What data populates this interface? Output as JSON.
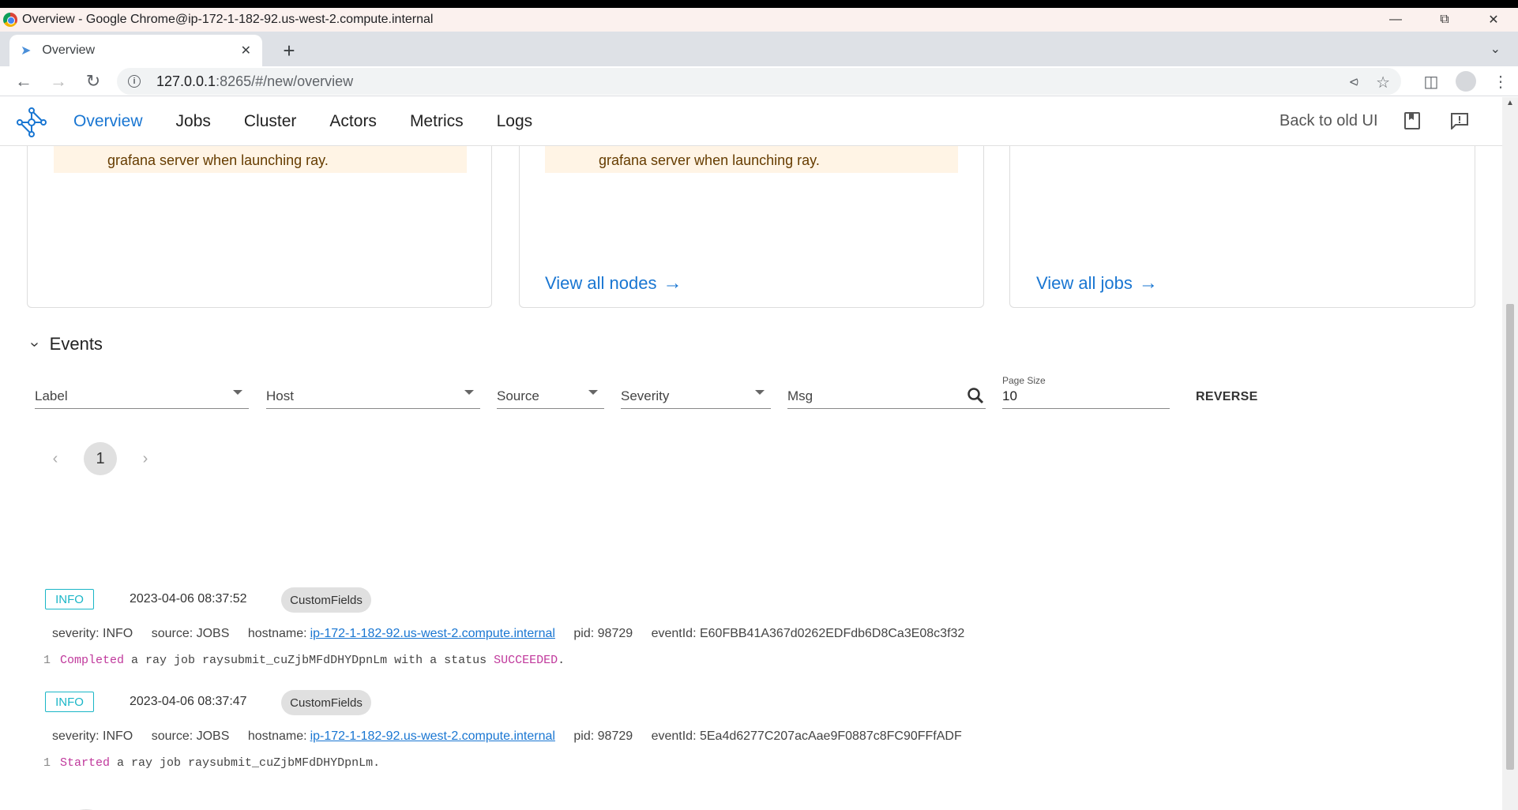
{
  "browser": {
    "window_title": "Overview - Google Chrome@ip-172-1-182-92.us-west-2.compute.internal",
    "tab_title": "Overview",
    "url_host": "127.0.0.1",
    "url_rest": ":8265/#/new/overview"
  },
  "appbar": {
    "nav": [
      "Overview",
      "Jobs",
      "Cluster",
      "Actors",
      "Metrics",
      "Logs"
    ],
    "active": "Overview",
    "back_label": "Back to old UI"
  },
  "cards": {
    "warning_text": "grafana server when launching ray.",
    "view_nodes": "View all nodes",
    "view_jobs": "View all jobs"
  },
  "events": {
    "title": "Events",
    "filters": {
      "label": "Label",
      "host": "Host",
      "source": "Source",
      "severity": "Severity",
      "msg": "Msg",
      "page_size_label": "Page Size",
      "page_size": "10",
      "reverse": "REVERSE"
    },
    "page": "1",
    "items": [
      {
        "level": "INFO",
        "time": "2023-04-06 08:37:52",
        "chip": "CustomFields",
        "severity": "severity: INFO",
        "source": "source: JOBS",
        "hostname_label": "hostname:",
        "hostname": "ip-172-1-182-92.us-west-2.compute.internal",
        "pid": "pid: 98729",
        "event_id": "eventId: E60FBB41A367d0262EDFdb6D8Ca3E08c3f32",
        "line_no": "1",
        "msg_kw1": "Completed",
        "msg_mid": " a ray job raysubmit_cuZjbMFdDHYDpnLm with a status ",
        "msg_kw2": "SUCCEEDED",
        "msg_end": "."
      },
      {
        "level": "INFO",
        "time": "2023-04-06 08:37:47",
        "chip": "CustomFields",
        "severity": "severity: INFO",
        "source": "source: JOBS",
        "hostname_label": "hostname:",
        "hostname": "ip-172-1-182-92.us-west-2.compute.internal",
        "pid": "pid: 98729",
        "event_id": "eventId: 5Ea4d6277C207acAae9F0887c8FC90FFfADF",
        "line_no": "1",
        "msg_kw1": "Started",
        "msg_mid": " a ray job raysubmit_cuZjbMFdDHYDpnLm.",
        "msg_kw2": "",
        "msg_end": ""
      }
    ]
  },
  "colors": {
    "accent": "#1976d2",
    "info": "#1ab6c7",
    "warning_bg": "#fff4e5",
    "keyword": "#c0399c"
  }
}
